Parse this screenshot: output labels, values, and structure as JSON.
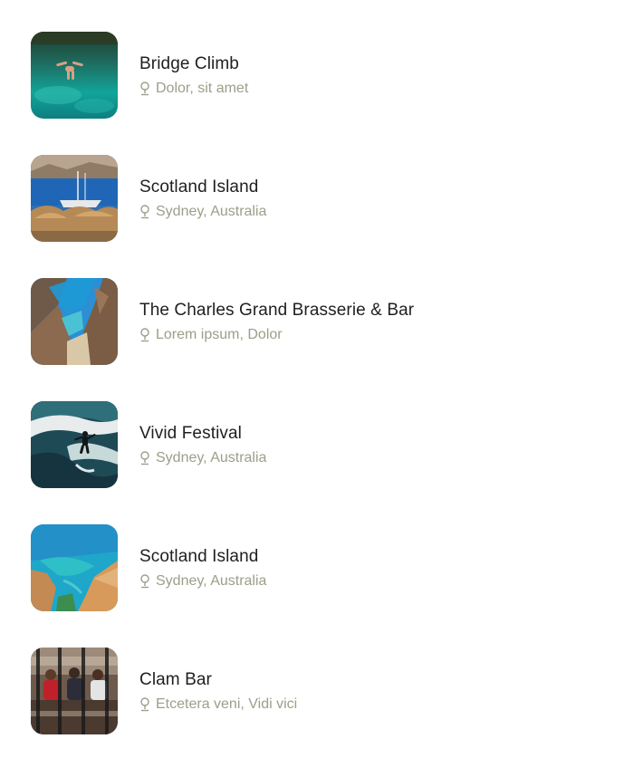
{
  "places": [
    {
      "title": "Bridge Climb",
      "location": "Dolor, sit amet",
      "image": "cliff-jumper-lagoon-photo"
    },
    {
      "title": "Scotland Island",
      "location": "Sydney, Australia",
      "image": "boat-beach-umbrellas-photo"
    },
    {
      "title": "The Charles Grand Brasserie & Bar",
      "location": "Lorem ipsum, Dolor",
      "image": "rocky-cove-beach-photo"
    },
    {
      "title": "Vivid Festival",
      "location": "Sydney, Australia",
      "image": "surfer-wave-photo"
    },
    {
      "title": "Scotland Island",
      "location": "Sydney, Australia",
      "image": "turquoise-coast-cliffs-photo"
    },
    {
      "title": "Clam Bar",
      "location": "Etcetera veni, Vidi vici",
      "image": "crowd-behind-fence-photo"
    }
  ],
  "icons": {
    "location": "map-pin-icon"
  },
  "colors": {
    "title": "#1f1f1f",
    "location": "#9aa08a",
    "background": "#ffffff"
  }
}
